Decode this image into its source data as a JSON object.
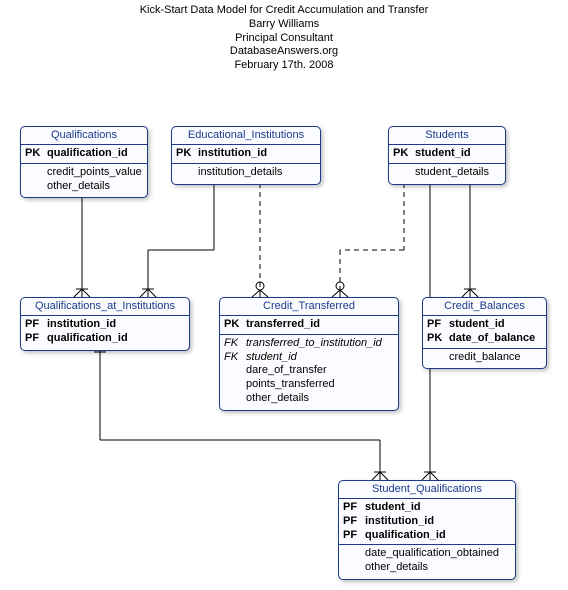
{
  "title": {
    "line1": "Kick-Start Data Model for Credit Accumulation  and Transfer",
    "line2": "Barry Williams",
    "line3": "Principal Consultant",
    "line4": "DatabaseAnswers.org",
    "line5": "February 17th. 2008"
  },
  "entities": {
    "qualifications": {
      "name": "Qualifications",
      "keys": {
        "pk": "PK"
      },
      "cols": {
        "id": "qualification_id",
        "credits": "credit_points_value",
        "other": "other_details"
      }
    },
    "institutions": {
      "name": "Educational_Institutions",
      "keys": {
        "pk": "PK"
      },
      "cols": {
        "id": "institution_id",
        "details": "institution_details"
      }
    },
    "students": {
      "name": "Students",
      "keys": {
        "pk": "PK"
      },
      "cols": {
        "id": "student_id",
        "details": "student_details"
      }
    },
    "qai": {
      "name": "Qualifications_at_Institutions",
      "keys": {
        "pf1": "PF",
        "pf2": "PF"
      },
      "cols": {
        "inst": "institution_id",
        "qual": "qualification_id"
      }
    },
    "credit_transferred": {
      "name": "Credit_Transferred",
      "keys": {
        "pk": "PK",
        "fk1": "FK",
        "fk2": "FK"
      },
      "cols": {
        "id": "transferred_id",
        "to_inst": "transferred_to_institution_id",
        "student": "student_id",
        "date": "dare_of_transfer",
        "points": "points_transferred",
        "other": "other_details"
      }
    },
    "credit_balances": {
      "name": "Credit_Balances",
      "keys": {
        "pf": "PF",
        "pk": "PK"
      },
      "cols": {
        "student": "student_id",
        "date": "date_of_balance",
        "balance": "credit_balance"
      }
    },
    "student_qualifications": {
      "name": "Student_Qualifications",
      "keys": {
        "pf1": "PF",
        "pf2": "PF",
        "pf3": "PF"
      },
      "cols": {
        "student": "student_id",
        "inst": "institution_id",
        "qual": "qualification_id",
        "date": "date_qualification_obtained",
        "other": "other_details"
      }
    }
  }
}
